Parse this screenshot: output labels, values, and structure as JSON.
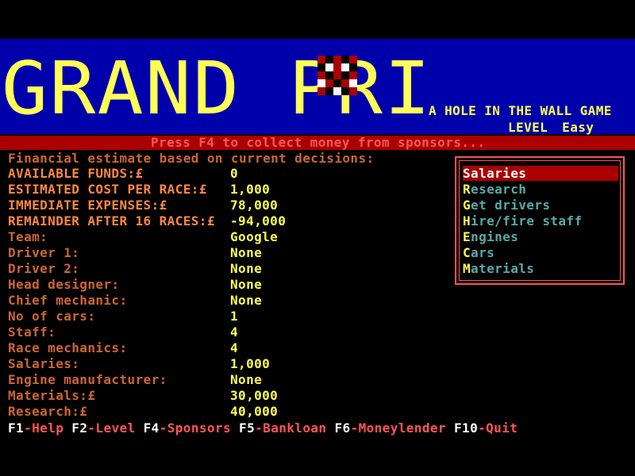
{
  "header": {
    "logo_text": "GRAND PRI",
    "tagline": "A HOLE IN THE WALL GAME",
    "level_label": "LEVEL",
    "level_value": "Easy"
  },
  "message": "Press F4 to collect money from sponsors...",
  "estimate_heading": "Financial estimate based on current decisions:",
  "rows": [
    {
      "label": "AVAILABLE FUNDS:£",
      "value": "0"
    },
    {
      "label": "ESTIMATED COST PER RACE:£",
      "value": "1,000"
    },
    {
      "label": "IMMEDIATE EXPENSES:£",
      "value": "78,000"
    },
    {
      "label": "REMAINDER AFTER 16 RACES:£",
      "value": "-94,000"
    },
    {
      "label": "Team:",
      "value": "Google"
    },
    {
      "label": "Driver 1:",
      "value": "None"
    },
    {
      "label": "Driver 2:",
      "value": "None"
    },
    {
      "label": "Head designer:",
      "value": "None"
    },
    {
      "label": "Chief mechanic:",
      "value": "None"
    },
    {
      "label": "No of cars:",
      "value": "1"
    },
    {
      "label": "Staff:",
      "value": "4"
    },
    {
      "label": "Race mechanics:",
      "value": "4"
    },
    {
      "label": "Salaries:",
      "value": "1,000"
    },
    {
      "label": "Engine manufacturer:",
      "value": "None"
    },
    {
      "label": "Materials:£",
      "value": "30,000"
    },
    {
      "label": "Research:£",
      "value": "40,000"
    }
  ],
  "menu": [
    {
      "hotkey": "S",
      "rest": "alaries",
      "selected": true
    },
    {
      "hotkey": "R",
      "rest": "esearch",
      "selected": false
    },
    {
      "hotkey": "G",
      "rest": "et drivers",
      "selected": false
    },
    {
      "hotkey": "H",
      "rest": "ire/fire staff",
      "selected": false
    },
    {
      "hotkey": "E",
      "rest": "ngines",
      "selected": false
    },
    {
      "hotkey": "C",
      "rest": "ars",
      "selected": false
    },
    {
      "hotkey": "M",
      "rest": "aterials",
      "selected": false
    }
  ],
  "footer": [
    {
      "key": "F1",
      "action": "-Help"
    },
    {
      "key": "F2",
      "action": "-Level"
    },
    {
      "key": "F4",
      "action": "-Sponsors"
    },
    {
      "key": "F5",
      "action": "-Bankloan"
    },
    {
      "key": "F6",
      "action": "-Moneylender"
    },
    {
      "key": "F10",
      "action": "-Quit"
    }
  ],
  "colors": {
    "banner": "#0000aa",
    "accent_red": "#aa0000",
    "text_yellow": "#ffff55",
    "text_orange": "#ff8844",
    "menu_cyan": "#55aaaa"
  }
}
